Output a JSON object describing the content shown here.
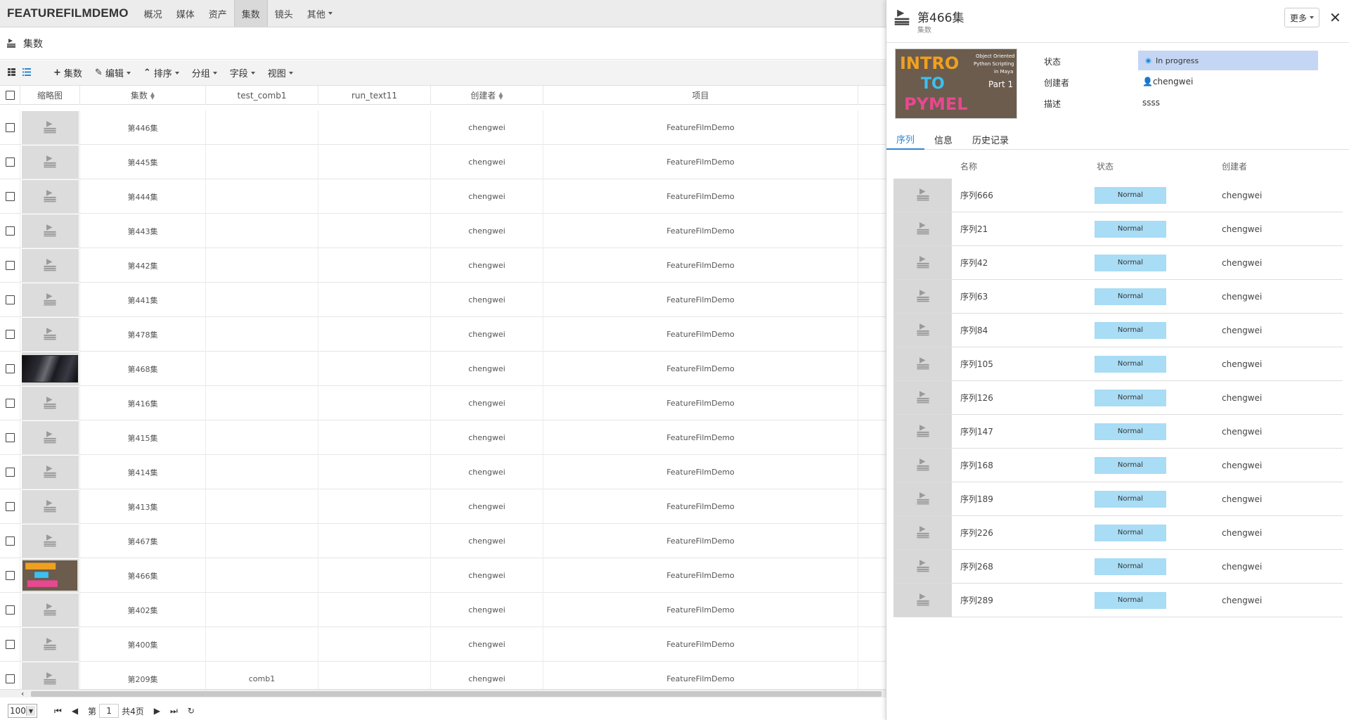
{
  "nav": {
    "brand": "FEATUREFILMDEMO",
    "items": [
      {
        "label": "概况"
      },
      {
        "label": "媒体"
      },
      {
        "label": "资产"
      },
      {
        "label": "集数"
      },
      {
        "label": "镜头"
      },
      {
        "label": "其他"
      }
    ]
  },
  "page": {
    "title": "集数"
  },
  "toolbar": {
    "add_label": "集数",
    "edit_label": "编辑",
    "sort_label": "排序",
    "group_label": "分组",
    "field_label": "字段",
    "view_label": "视图"
  },
  "table": {
    "columns": [
      "缩略图",
      "集数",
      "test_comb1",
      "run_text11",
      "创建者",
      "项目"
    ],
    "rows": [
      {
        "name": "第446集",
        "test_comb1": "",
        "creator": "chengwei",
        "project": "FeatureFilmDemo",
        "thumb": "default"
      },
      {
        "name": "第445集",
        "test_comb1": "",
        "creator": "chengwei",
        "project": "FeatureFilmDemo",
        "thumb": "default"
      },
      {
        "name": "第444集",
        "test_comb1": "",
        "creator": "chengwei",
        "project": "FeatureFilmDemo",
        "thumb": "default"
      },
      {
        "name": "第443集",
        "test_comb1": "",
        "creator": "chengwei",
        "project": "FeatureFilmDemo",
        "thumb": "default"
      },
      {
        "name": "第442集",
        "test_comb1": "",
        "creator": "chengwei",
        "project": "FeatureFilmDemo",
        "thumb": "default"
      },
      {
        "name": "第441集",
        "test_comb1": "",
        "creator": "chengwei",
        "project": "FeatureFilmDemo",
        "thumb": "default"
      },
      {
        "name": "第478集",
        "test_comb1": "",
        "creator": "chengwei",
        "project": "FeatureFilmDemo",
        "thumb": "default"
      },
      {
        "name": "第468集",
        "test_comb1": "",
        "creator": "chengwei",
        "project": "FeatureFilmDemo",
        "thumb": "dark"
      },
      {
        "name": "第416集",
        "test_comb1": "",
        "creator": "chengwei",
        "project": "FeatureFilmDemo",
        "thumb": "default"
      },
      {
        "name": "第415集",
        "test_comb1": "",
        "creator": "chengwei",
        "project": "FeatureFilmDemo",
        "thumb": "default"
      },
      {
        "name": "第414集",
        "test_comb1": "",
        "creator": "chengwei",
        "project": "FeatureFilmDemo",
        "thumb": "default"
      },
      {
        "name": "第413集",
        "test_comb1": "",
        "creator": "chengwei",
        "project": "FeatureFilmDemo",
        "thumb": "default"
      },
      {
        "name": "第467集",
        "test_comb1": "",
        "creator": "chengwei",
        "project": "FeatureFilmDemo",
        "thumb": "default"
      },
      {
        "name": "第466集",
        "test_comb1": "",
        "creator": "chengwei",
        "project": "FeatureFilmDemo",
        "thumb": "pymel"
      },
      {
        "name": "第402集",
        "test_comb1": "",
        "creator": "chengwei",
        "project": "FeatureFilmDemo",
        "thumb": "default"
      },
      {
        "name": "第400集",
        "test_comb1": "",
        "creator": "chengwei",
        "project": "FeatureFilmDemo",
        "thumb": "default"
      },
      {
        "name": "第209集",
        "test_comb1": "comb1",
        "creator": "chengwei",
        "project": "FeatureFilmDemo",
        "thumb": "default"
      }
    ]
  },
  "pager": {
    "page_size": "100",
    "page_prefix": "第",
    "current_page": "1",
    "total_pages": "共4页"
  },
  "panel": {
    "title": "第466集",
    "subtitle": "集数",
    "more_label": "更多",
    "close_glyph": "✕",
    "thumb_text": {
      "line1": "INTRO",
      "line2": "TO",
      "line3": "PYMEL",
      "caption1": "Object Oriented",
      "caption2": "Python Scripting",
      "caption3": "in Maya",
      "part": "Part 1"
    },
    "fields": {
      "status_label": "状态",
      "status_value": "In progress",
      "creator_label": "创建者",
      "creator_value": "chengwei",
      "desc_label": "描述",
      "desc_value": "ssss"
    },
    "tabs": [
      "序列",
      "信息",
      "历史记录"
    ],
    "seq_columns": [
      "名称",
      "状态",
      "创建者"
    ],
    "sequences": [
      {
        "name": "序列666",
        "status": "Normal",
        "creator": "chengwei"
      },
      {
        "name": "序列21",
        "status": "Normal",
        "creator": "chengwei"
      },
      {
        "name": "序列42",
        "status": "Normal",
        "creator": "chengwei"
      },
      {
        "name": "序列63",
        "status": "Normal",
        "creator": "chengwei"
      },
      {
        "name": "序列84",
        "status": "Normal",
        "creator": "chengwei"
      },
      {
        "name": "序列105",
        "status": "Normal",
        "creator": "chengwei"
      },
      {
        "name": "序列126",
        "status": "Normal",
        "creator": "chengwei"
      },
      {
        "name": "序列147",
        "status": "Normal",
        "creator": "chengwei"
      },
      {
        "name": "序列168",
        "status": "Normal",
        "creator": "chengwei"
      },
      {
        "name": "序列189",
        "status": "Normal",
        "creator": "chengwei"
      },
      {
        "name": "序列226",
        "status": "Normal",
        "creator": "chengwei"
      },
      {
        "name": "序列268",
        "status": "Normal",
        "creator": "chengwei"
      },
      {
        "name": "序列289",
        "status": "Normal",
        "creator": "chengwei"
      }
    ]
  },
  "colors": {
    "accent": "#2e86d4",
    "status_in_progress_bg": "#c5d6f4",
    "status_normal_bg": "#a9dcf5"
  }
}
